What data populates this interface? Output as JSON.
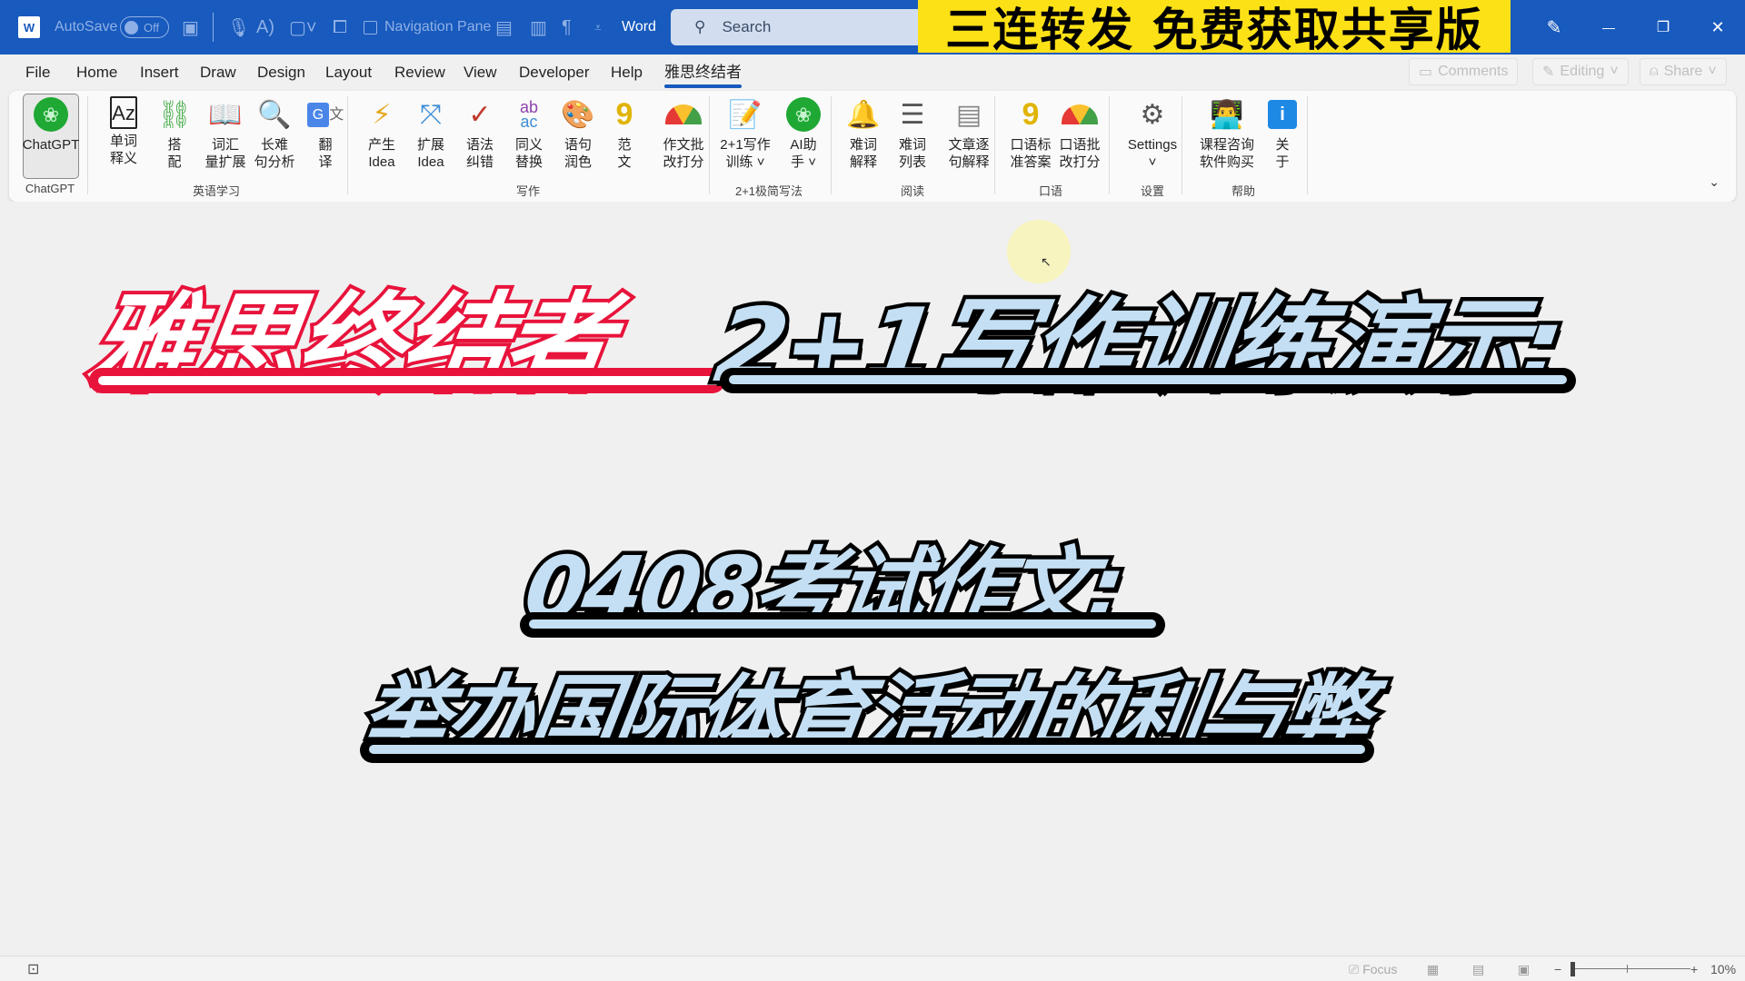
{
  "titlebar": {
    "app_logo": "W",
    "autosave_label": "AutoSave",
    "autosave_state": "Off",
    "navigation_pane_label": "Navigation Pane",
    "app_name": "Word",
    "search_placeholder": "Search",
    "banner_text": "三连转发 免费获取共享版",
    "icons": [
      "save-icon",
      "microphone-icon",
      "read-aloud-icon",
      "comment-icon",
      "touch-mode-icon",
      "layout-icon",
      "page-icon",
      "pilcrow-icon",
      "customize-icon"
    ],
    "pen_icon": "✎",
    "minimize": "—",
    "restore": "❐",
    "close": "✕"
  },
  "tabs": [
    "File",
    "Home",
    "Insert",
    "Draw",
    "Design",
    "Layout",
    "Review",
    "View",
    "Developer",
    "Help",
    "雅思终结者"
  ],
  "active_tab": "雅思终结者",
  "right_buttons": {
    "comments": "Comments",
    "editing": "Editing",
    "share": "Share"
  },
  "ribbon": {
    "groups": [
      {
        "label": "ChatGPT",
        "buttons": [
          {
            "label": "ChatGPT"
          }
        ]
      },
      {
        "label": "英语学习",
        "buttons": [
          {
            "label1": "单词",
            "label2": "释义"
          },
          {
            "label1": "搭",
            "label2": "配"
          },
          {
            "label1": "词汇",
            "label2": "量扩展"
          },
          {
            "label1": "长难",
            "label2": "句分析"
          },
          {
            "label1": "翻",
            "label2": "译"
          }
        ]
      },
      {
        "label": "写作",
        "buttons": [
          {
            "label1": "产生",
            "label2": "Idea"
          },
          {
            "label1": "扩展",
            "label2": "Idea"
          },
          {
            "label1": "语法",
            "label2": "纠错"
          },
          {
            "label1": "同义",
            "label2": "替换"
          },
          {
            "label1": "语句",
            "label2": "润色"
          },
          {
            "label1": "范",
            "label2": "文"
          },
          {
            "label1": "作文批",
            "label2": "改打分"
          }
        ]
      },
      {
        "label": "2+1极简写法",
        "buttons": [
          {
            "label1": "2+1写作",
            "label2": "训练 ˅"
          },
          {
            "label1": "AI助",
            "label2": "手 ˅"
          }
        ]
      },
      {
        "label": "阅读",
        "buttons": [
          {
            "label1": "难词",
            "label2": "解释"
          },
          {
            "label1": "难词",
            "label2": "列表"
          },
          {
            "label1": "文章逐",
            "label2": "句解释"
          }
        ]
      },
      {
        "label": "口语",
        "buttons": [
          {
            "label1": "口语标",
            "label2": "准答案"
          },
          {
            "label1": "口语批",
            "label2": "改打分"
          }
        ]
      },
      {
        "label": "设置",
        "buttons": [
          {
            "label1": "Settings",
            "label2": "˅"
          }
        ]
      },
      {
        "label": "帮助",
        "buttons": [
          {
            "label1": "课程咨询",
            "label2": "软件购买"
          },
          {
            "label1": "关",
            "label2": "于"
          }
        ]
      }
    ]
  },
  "document": {
    "heading_red": "雅思终结者",
    "heading_blue": "2+1写作训练演示:",
    "line2": "0408考试作文:",
    "line3": "举办国际体育活动的利与弊"
  },
  "statusbar": {
    "focus_label": "Focus",
    "zoom_minus": "−",
    "zoom_plus": "+",
    "zoom_level": "10%",
    "zoom_fraction": 0.1
  },
  "colors": {
    "titlebar": "#185abd",
    "banner": "#fde117",
    "heading_red": "#e8133b",
    "heading_blue_fill": "#c4dff3",
    "chatgpt_green": "#1fa834"
  }
}
